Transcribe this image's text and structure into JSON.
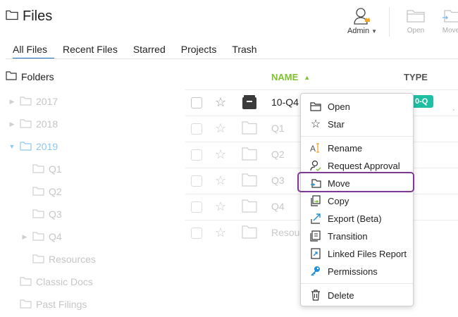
{
  "app": {
    "title": "Files"
  },
  "user": {
    "name": "Admin"
  },
  "toolbar": {
    "open_label": "Open",
    "move_label": "Move"
  },
  "tabs": [
    {
      "label": "All Files",
      "active": true
    },
    {
      "label": "Recent Files",
      "active": false
    },
    {
      "label": "Starred",
      "active": false
    },
    {
      "label": "Projects",
      "active": false
    },
    {
      "label": "Trash",
      "active": false
    }
  ],
  "folders_header": "Folders",
  "tree": [
    {
      "label": "2017"
    },
    {
      "label": "2018"
    },
    {
      "label": "2019"
    },
    {
      "label": "Q1"
    },
    {
      "label": "Q2"
    },
    {
      "label": "Q3"
    },
    {
      "label": "Q4"
    },
    {
      "label": "Resources"
    },
    {
      "label": "Classic Docs"
    },
    {
      "label": "Past Filings"
    }
  ],
  "columns": {
    "name": "NAME",
    "type": "TYPE"
  },
  "rows": [
    {
      "name": "10-Q4",
      "badge": "0-Q"
    },
    {
      "name": "Q1"
    },
    {
      "name": "Q2"
    },
    {
      "name": "Q3"
    },
    {
      "name": "Q4"
    },
    {
      "name": "Resou"
    }
  ],
  "context_menu": [
    {
      "label": "Open",
      "icon": "folder-open-icon"
    },
    {
      "label": "Star",
      "icon": "star-icon"
    },
    {
      "label": "Rename",
      "icon": "rename-icon"
    },
    {
      "label": "Request Approval",
      "icon": "approval-icon"
    },
    {
      "label": "Move",
      "icon": "move-icon"
    },
    {
      "label": "Copy",
      "icon": "copy-icon"
    },
    {
      "label": "Export (Beta)",
      "icon": "export-icon"
    },
    {
      "label": "Transition",
      "icon": "transition-icon"
    },
    {
      "label": "Linked Files Report",
      "icon": "linked-files-icon"
    },
    {
      "label": "Permissions",
      "icon": "permissions-icon"
    },
    {
      "label": "Delete",
      "icon": "trash-icon"
    }
  ],
  "colors": {
    "accent_green": "#7ec22d",
    "tab_underline": "#1e6fc8",
    "badge_teal": "#1fbfa3",
    "highlight_purple": "#7c3a92"
  }
}
